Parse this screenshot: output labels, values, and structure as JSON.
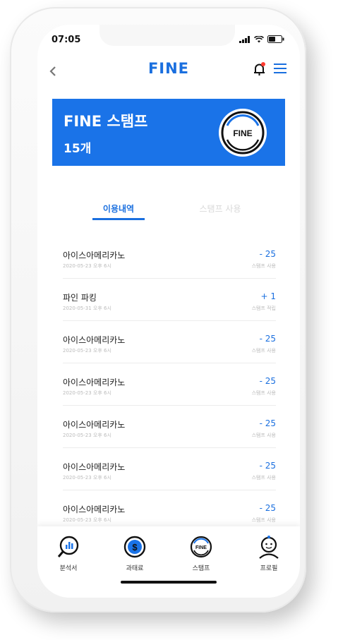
{
  "status_bar": {
    "time": "07:05"
  },
  "header": {
    "logo": "FINE"
  },
  "banner": {
    "title": "FINE 스탬프",
    "count": "15개",
    "badge_text": "FINE"
  },
  "tabs": [
    {
      "label": "이용내역",
      "active": true
    },
    {
      "label": "스탬프 사용",
      "active": false
    }
  ],
  "history": [
    {
      "name": "아이스아메리카노",
      "date": "2020-05-23 오후 6시",
      "amount": "- 25",
      "type": "스탬프 사용"
    },
    {
      "name": "파인 파킹",
      "date": "2020-05-31 오후 6시",
      "amount": "+ 1",
      "type": "스탬프 적립"
    },
    {
      "name": "아이스아메리카노",
      "date": "2020-05-23 오후 6시",
      "amount": "- 25",
      "type": "스탬프 사용"
    },
    {
      "name": "아이스아메리카노",
      "date": "2020-05-23 오후 6시",
      "amount": "- 25",
      "type": "스탬프 사용"
    },
    {
      "name": "아이스아메리카노",
      "date": "2020-05-23 오후 6시",
      "amount": "- 25",
      "type": "스탬프 사용"
    },
    {
      "name": "아이스아메리카노",
      "date": "2020-05-23 오후 6시",
      "amount": "- 25",
      "type": "스탬프 사용"
    },
    {
      "name": "아이스아메리카노",
      "date": "2020-05-23 오후 6시",
      "amount": "- 25",
      "type": "스탬프 사용"
    }
  ],
  "bottom_nav": [
    {
      "label": "분석서",
      "icon": "analysis-icon"
    },
    {
      "label": "과태료",
      "icon": "fine-payment-icon"
    },
    {
      "label": "스탬프",
      "icon": "stamp-icon"
    },
    {
      "label": "프로필",
      "icon": "profile-icon"
    }
  ],
  "colors": {
    "accent": "#1a73e8",
    "text": "#222222",
    "muted": "#bbbbbb",
    "notification": "#ff3b30"
  }
}
